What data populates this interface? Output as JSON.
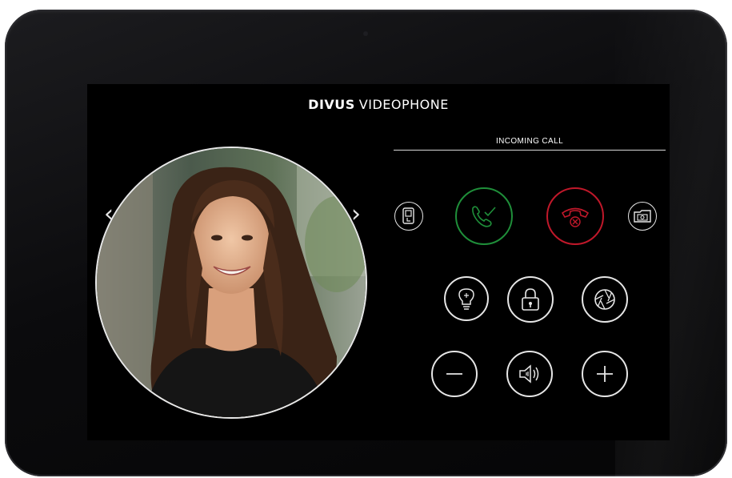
{
  "header": {
    "brand": "DIVUS",
    "product": "VIDEOPHONE"
  },
  "call": {
    "status": "INCOMING CALL"
  },
  "video": {
    "prev_arrow": "‹",
    "next_arrow": "›"
  },
  "controls": {
    "row1": [
      {
        "name": "intercom-icon",
        "color": "#e6e6e6"
      },
      {
        "name": "accept-call-icon",
        "color": "#1f8f3a"
      },
      {
        "name": "reject-call-icon",
        "color": "#c0182a"
      },
      {
        "name": "snapshot-gallery-icon",
        "color": "#e6e6e6"
      }
    ],
    "row2": [
      {
        "name": "light-bulb-icon"
      },
      {
        "name": "lock-icon"
      },
      {
        "name": "camera-shutter-icon"
      }
    ],
    "row3": [
      {
        "name": "minus-icon"
      },
      {
        "name": "speaker-volume-icon"
      },
      {
        "name": "plus-icon"
      }
    ]
  },
  "colors": {
    "accept": "#1f8f3a",
    "reject": "#c0182a",
    "foreground": "#ffffff",
    "background": "#000000"
  }
}
